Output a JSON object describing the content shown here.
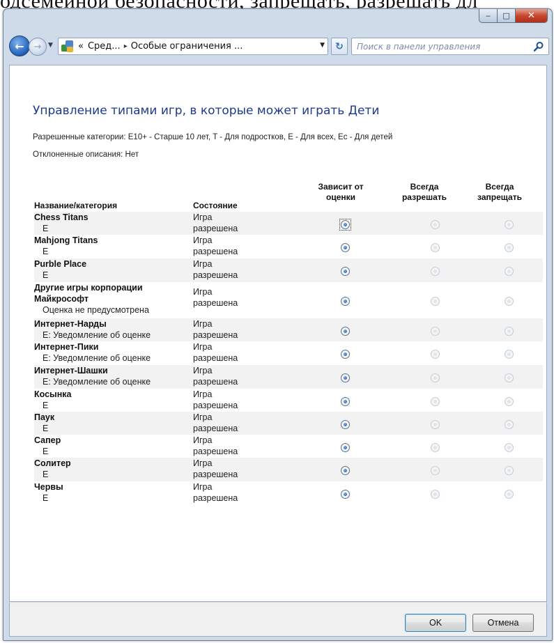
{
  "document_fragment": "одсемейной безопасности, запрещать, разрешать дл",
  "window": {
    "minimize_glyph": "‒",
    "maximize_glyph": "□",
    "close_glyph": "✕"
  },
  "address_bar": {
    "crumbs": [
      "«",
      "Сред...",
      "Особые ограничения ..."
    ],
    "separator": "▸",
    "dropdown_glyph": "▼",
    "search_placeholder": "Поиск в панели управления"
  },
  "page": {
    "title": "Управление типами игр, в которые может играть Дети",
    "allowed_label": "Разрешенные категории:",
    "allowed_value": "E10+ - Старше 10 лет, T - Для подростков, E - Для всех, Ec - Для детей",
    "declined_label": "Отклоненные описания:",
    "declined_value": "Нет"
  },
  "table": {
    "headers": {
      "name": "Название/категория",
      "status": "Состояние",
      "depends": [
        "Зависит от",
        "оценки"
      ],
      "always_allow": [
        "Всегда",
        "разрешать"
      ],
      "always_block": [
        "Всегда",
        "запрещать"
      ]
    },
    "rows": [
      {
        "name": "Chess Titans",
        "rating": "E",
        "status": "Игра разрешена",
        "selected": "depends"
      },
      {
        "name": "Mahjong Titans",
        "rating": "E",
        "status": "Игра разрешена",
        "selected": "depends"
      },
      {
        "name": "Purble Place",
        "rating": "E",
        "status": "Игра разрешена",
        "selected": "depends"
      },
      {
        "name": "Другие игры корпорации Майкрософт",
        "rating": "Оценка не предусмотрена",
        "status": "Игра разрешена",
        "selected": "depends"
      },
      {
        "name": "Интернет-Нарды",
        "rating": "E: Уведомление об оценке",
        "status": "Игра разрешена",
        "selected": "depends"
      },
      {
        "name": "Интернет-Пики",
        "rating": "E: Уведомление об оценке",
        "status": "Игра разрешена",
        "selected": "depends"
      },
      {
        "name": "Интернет-Шашки",
        "rating": "E: Уведомление об оценке",
        "status": "Игра разрешена",
        "selected": "depends"
      },
      {
        "name": "Косынка",
        "rating": "E",
        "status": "Игра разрешена",
        "selected": "depends"
      },
      {
        "name": "Паук",
        "rating": "E",
        "status": "Игра разрешена",
        "selected": "depends"
      },
      {
        "name": "Сапер",
        "rating": "E",
        "status": "Игра разрешена",
        "selected": "depends"
      },
      {
        "name": "Солитер",
        "rating": "E",
        "status": "Игра разрешена",
        "selected": "depends"
      },
      {
        "name": "Червы",
        "rating": "E",
        "status": "Игра разрешена",
        "selected": "depends"
      }
    ]
  },
  "footer": {
    "ok_label": "OK",
    "cancel_label": "Отмена"
  }
}
